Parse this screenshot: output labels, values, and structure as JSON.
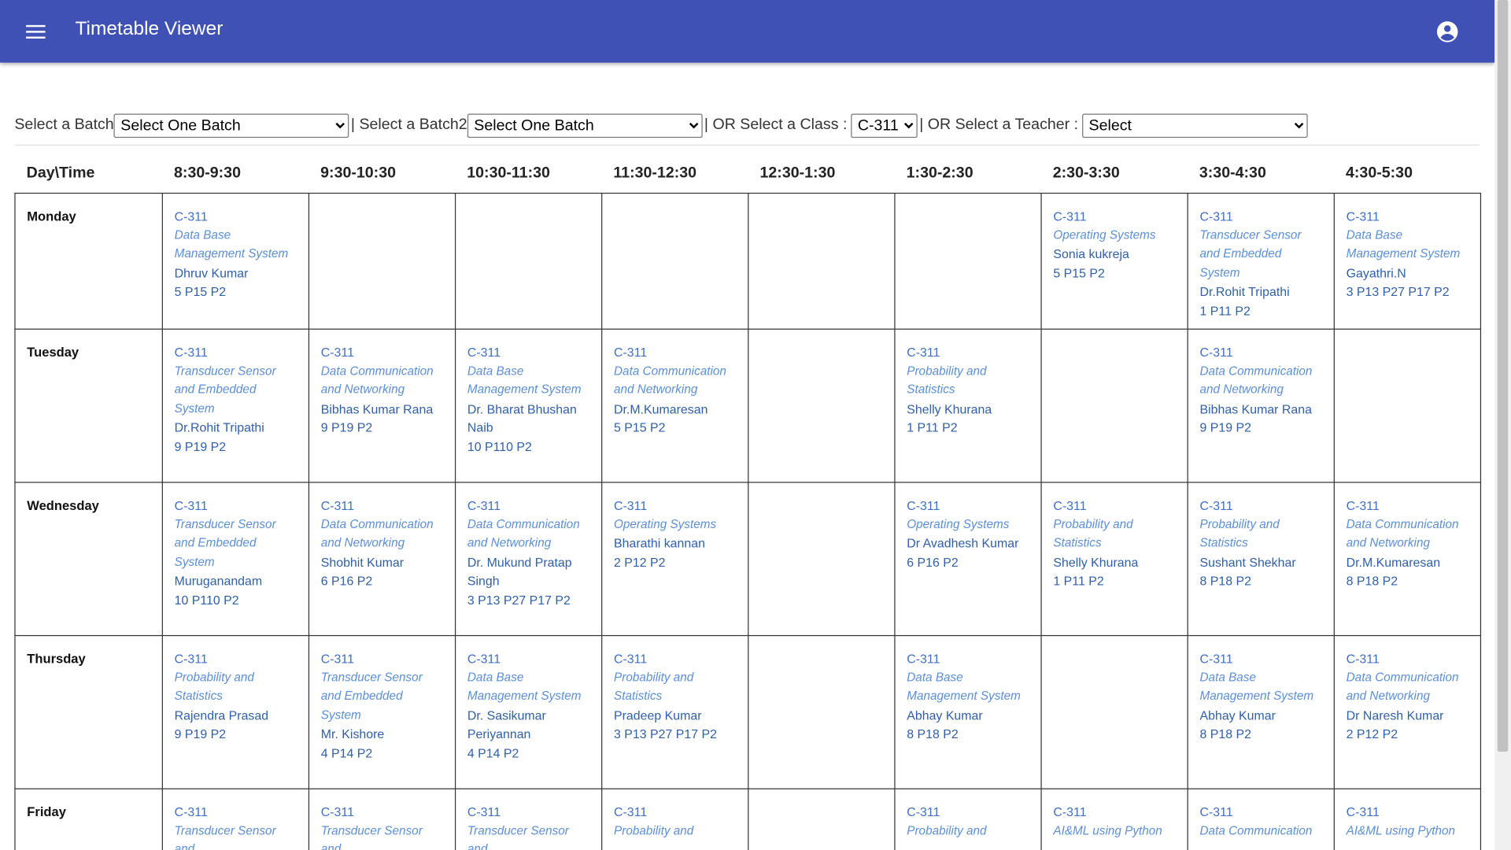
{
  "app": {
    "title": "Timetable Viewer"
  },
  "filters": {
    "batch_label": "Select a Batch",
    "batch_value": "Select One Batch",
    "batch2_label": "| Select a Batch2",
    "batch2_value": "Select One Batch",
    "class_label": "| OR Select a Class :",
    "class_value": "C-311",
    "teacher_label": "| OR Select a Teacher :",
    "teacher_value": "Select"
  },
  "timetable": {
    "header": [
      "Day\\Time",
      "8:30-9:30",
      "9:30-10:30",
      "10:30-11:30",
      "11:30-12:30",
      "12:30-1:30",
      "1:30-2:30",
      "2:30-3:30",
      "3:30-4:30",
      "4:30-5:30"
    ],
    "rows": [
      {
        "day": "Monday",
        "cells": [
          {
            "room": "C-311",
            "subject": "Data Base Management System",
            "teacher": "Dhruv Kumar",
            "batches": "5 P15 P2"
          },
          null,
          null,
          null,
          null,
          null,
          {
            "room": "C-311",
            "subject": "Operating Systems",
            "teacher": "Sonia kukreja",
            "batches": "5 P15 P2"
          },
          {
            "room": "C-311",
            "subject": "Transducer Sensor and Embedded System",
            "teacher": "Dr.Rohit Tripathi",
            "batches": "1 P11 P2"
          },
          {
            "room": "C-311",
            "subject": "Data Base Management System",
            "teacher": "Gayathri.N",
            "batches": "3 P13 P27 P17 P2"
          }
        ]
      },
      {
        "day": "Tuesday",
        "cells": [
          {
            "room": "C-311",
            "subject": "Transducer Sensor and Embedded System",
            "teacher": "Dr.Rohit Tripathi",
            "batches": "9 P19 P2"
          },
          {
            "room": "C-311",
            "subject": "Data Communication and Networking",
            "teacher": "Bibhas Kumar Rana",
            "batches": "9 P19 P2"
          },
          {
            "room": "C-311",
            "subject": "Data Base Management System",
            "teacher": "Dr. Bharat Bhushan Naib",
            "batches": "10 P110 P2"
          },
          {
            "room": "C-311",
            "subject": "Data Communication and Networking",
            "teacher": "Dr.M.Kumaresan",
            "batches": "5 P15 P2"
          },
          null,
          {
            "room": "C-311",
            "subject": "Probability and Statistics",
            "teacher": "Shelly Khurana",
            "batches": "1 P11 P2"
          },
          null,
          {
            "room": "C-311",
            "subject": "Data Communication and Networking",
            "teacher": "Bibhas Kumar Rana",
            "batches": "9 P19 P2"
          },
          null
        ]
      },
      {
        "day": "Wednesday",
        "cells": [
          {
            "room": "C-311",
            "subject": "Transducer Sensor and Embedded System",
            "teacher": "Muruganandam",
            "batches": "10 P110 P2"
          },
          {
            "room": "C-311",
            "subject": "Data Communication and Networking",
            "teacher": "Shobhit Kumar",
            "batches": "6 P16 P2"
          },
          {
            "room": "C-311",
            "subject": "Data Communication and Networking",
            "teacher": "Dr. Mukund Pratap Singh",
            "batches": "3 P13 P27 P17 P2"
          },
          {
            "room": "C-311",
            "subject": "Operating Systems",
            "teacher": "Bharathi kannan",
            "batches": "2 P12 P2"
          },
          null,
          {
            "room": "C-311",
            "subject": "Operating Systems",
            "teacher": "Dr Avadhesh Kumar",
            "batches": "6 P16 P2"
          },
          {
            "room": "C-311",
            "subject": "Probability and Statistics",
            "teacher": "Shelly Khurana",
            "batches": "1 P11 P2"
          },
          {
            "room": "C-311",
            "subject": "Probability and Statistics",
            "teacher": "Sushant Shekhar",
            "batches": "8 P18 P2"
          },
          {
            "room": "C-311",
            "subject": "Data Communication and Networking",
            "teacher": "Dr.M.Kumaresan",
            "batches": "8 P18 P2"
          }
        ]
      },
      {
        "day": "Thursday",
        "cells": [
          {
            "room": "C-311",
            "subject": "Probability and Statistics",
            "teacher": "Rajendra Prasad",
            "batches": "9 P19 P2"
          },
          {
            "room": "C-311",
            "subject": "Transducer Sensor and Embedded System",
            "teacher": "Mr. Kishore",
            "batches": "4 P14 P2"
          },
          {
            "room": "C-311",
            "subject": "Data Base Management System",
            "teacher": "Dr. Sasikumar Periyannan",
            "batches": "4 P14 P2"
          },
          {
            "room": "C-311",
            "subject": "Probability and Statistics",
            "teacher": "Pradeep Kumar",
            "batches": "3 P13 P27 P17 P2"
          },
          null,
          {
            "room": "C-311",
            "subject": "Data Base Management System",
            "teacher": "Abhay Kumar",
            "batches": "8 P18 P2"
          },
          null,
          {
            "room": "C-311",
            "subject": "Data Base Management System",
            "teacher": "Abhay Kumar",
            "batches": "8 P18 P2"
          },
          {
            "room": "C-311",
            "subject": "Data Communication and Networking",
            "teacher": "Dr Naresh Kumar",
            "batches": "2 P12 P2"
          }
        ]
      },
      {
        "day": "Friday",
        "cells": [
          {
            "room": "C-311",
            "subject": "Transducer Sensor and"
          },
          {
            "room": "C-311",
            "subject": "Transducer Sensor and"
          },
          {
            "room": "C-311",
            "subject": "Transducer Sensor and"
          },
          {
            "room": "C-311",
            "subject": "Probability and"
          },
          null,
          {
            "room": "C-311",
            "subject": "Probability and"
          },
          {
            "room": "C-311",
            "subject": "AI&ML using Python"
          },
          {
            "room": "C-311",
            "subject": "Data Communication"
          },
          {
            "room": "C-311",
            "subject": "AI&ML using Python"
          }
        ]
      }
    ]
  }
}
